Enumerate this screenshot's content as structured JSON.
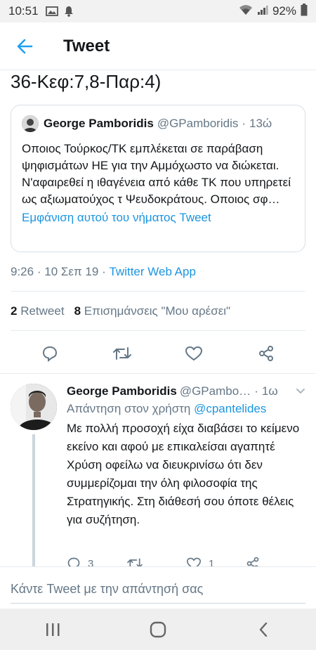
{
  "status_bar": {
    "time": "10:51",
    "battery": "92%",
    "icons": [
      "image-icon",
      "notification-bell-icon",
      "wifi-icon",
      "signal-icon",
      "battery-icon"
    ]
  },
  "header": {
    "title": "Tweet",
    "back_icon": "arrow-left-icon"
  },
  "tweet": {
    "text_tail": "36-Κεφ:7,8-Παρ:4)",
    "quote": {
      "name": "George Pamboridis",
      "handle": "@GPamboridis",
      "separator": "·",
      "time": "13ώ",
      "text": "Οποιος Τούρκος/ΤΚ εμπλέκεται σε παράβαση ψηφισμάτων ΗΕ για την Αμμόχωστο να διώκεται. Ν'αφαιρεθεί η ιθαγένεια από κάθε ΤΚ που υπηρετεί ως αξιωματούχος τ Ψευδοκράτους. Οποιος σφ…",
      "show_thread": "Εμφάνιση αυτού του νήματος Tweet"
    },
    "meta": {
      "time": "9:26",
      "sep": "·",
      "date": "10 Σεπ 19",
      "sep2": "·",
      "source": "Twitter Web App"
    },
    "stats": {
      "retweets_count": "2",
      "retweets_label": "Retweet",
      "likes_count": "8",
      "likes_label": "Επισημάνσεις \"Μου αρέσει\""
    },
    "actions": [
      "reply-icon",
      "retweet-icon",
      "like-icon",
      "share-icon"
    ]
  },
  "reply": {
    "name": "George Pamboridis",
    "handle": "@GPambo…",
    "separator": "·",
    "time": "1ω",
    "reply_to_prefix": "Απάντηση στον χρήστη",
    "reply_to_handle": "@cpantelides",
    "text": "Με πολλή προσοχή είχα διαβάσει το κείμενο εκείνο και αφού με επικαλείσαι αγαπητέ Χρύση οφείλω να διευκρινίσω ότι δεν συμμερίζομαι την όλη φιλοσοφία της Στρατηγικής. Στη διάθεσή σου όποτε θέλεις για συζήτηση.",
    "reply_count": "3",
    "retweet_count": "",
    "like_count": "1"
  },
  "compose": {
    "placeholder": "Κάντε Tweet με την απάντησή σας"
  },
  "nav": [
    "recent-apps-icon",
    "home-icon",
    "back-icon"
  ],
  "colors": {
    "accent": "#1b95e0",
    "muted": "#657786",
    "text": "#14171a"
  }
}
